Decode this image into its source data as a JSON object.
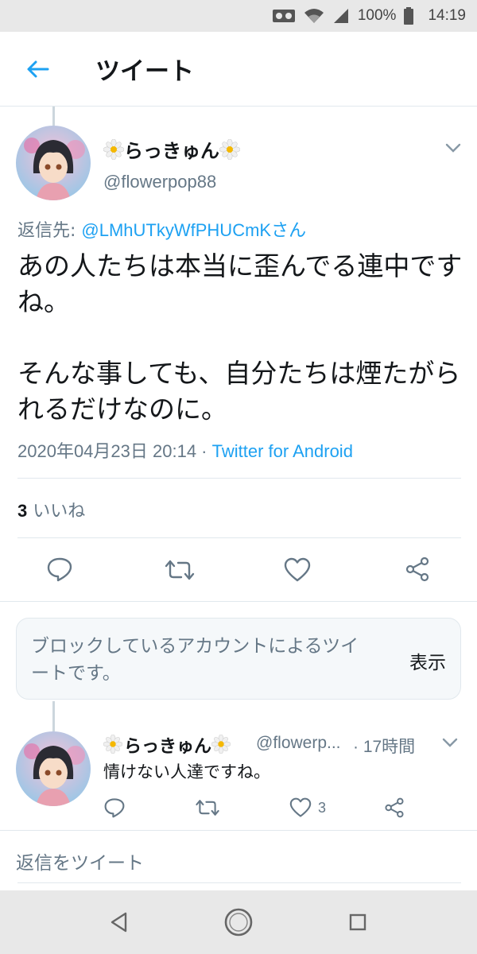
{
  "status_bar": {
    "battery": "100%",
    "time": "14:19"
  },
  "header": {
    "title": "ツイート"
  },
  "main_tweet": {
    "display_name": "らっきゅん",
    "handle": "@flowerpop88",
    "reply_prefix": "返信先: ",
    "reply_mention": "@LMhUTkyWfPHUCmKさん",
    "text": "あの人たちは本当に歪んでる連中ですね。\n\nそんな事しても、自分たちは煙たがられるだけなのに。",
    "timestamp": "2020年04月23日 20:14",
    "separator": " · ",
    "source": "Twitter for Android",
    "like_count": "3",
    "like_label": " いいね"
  },
  "blocked_notice": {
    "text": "ブロックしているアカウントによるツイートです。",
    "show_label": "表示"
  },
  "reply_tweet": {
    "display_name": "らっきゅん",
    "handle": "@flowerp...",
    "time": " · 17時間",
    "text": "情けない人達ですね。",
    "like_count": "3"
  },
  "compose": {
    "placeholder": "返信をツイート"
  },
  "colors": {
    "accent": "#1da1f2",
    "secondary_text": "#657786",
    "divider": "#e1e8ed"
  }
}
